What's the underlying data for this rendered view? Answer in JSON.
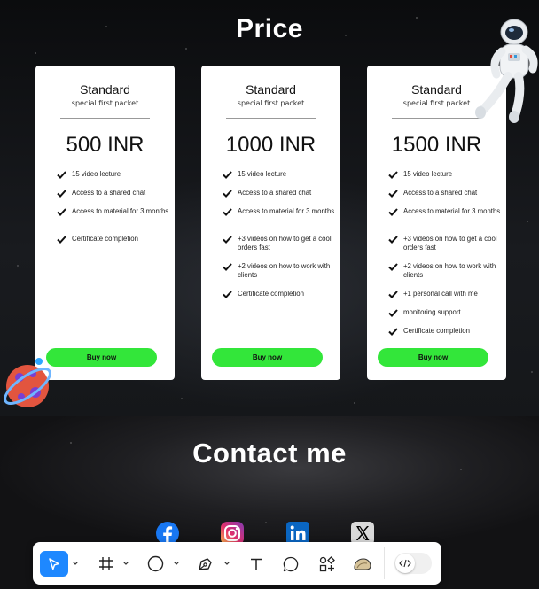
{
  "price_section": {
    "title": "Price"
  },
  "cards": [
    {
      "name": "Standard",
      "subtitle": "special first packet",
      "price": "500 INR",
      "features": [
        "15 video lecture",
        "Access to a shared chat",
        "Access to material for 3 months",
        "Certificate completion"
      ],
      "button": "Buy now"
    },
    {
      "name": "Standard",
      "subtitle": "special first packet",
      "price": "1000 INR",
      "features": [
        "15 video lecture",
        "Access to a shared chat",
        "Access to material for 3 months",
        "+3 videos on how to get a cool orders fast",
        "+2 videos on how to work with clients",
        "Certificate completion"
      ],
      "button": "Buy now"
    },
    {
      "name": "Standard",
      "subtitle": "special first packet",
      "price": "1500 INR",
      "features": [
        "15 video lecture",
        "Access to a shared chat",
        "Access to material for 3 months",
        "+3 videos on how to get a cool orders fast",
        "+2 videos on how to work with clients",
        "+1 personal call with me",
        "monitoring support",
        "Certificate completion"
      ],
      "button": "Buy now"
    }
  ],
  "contact_section": {
    "title": "Contact me",
    "socials": [
      {
        "icon": "facebook-icon",
        "color": "#1877f2"
      },
      {
        "icon": "instagram-icon",
        "color": "#e1306c"
      },
      {
        "icon": "linkedin-icon",
        "color": "#0a66c2"
      },
      {
        "icon": "x-icon",
        "color": "#000000"
      }
    ]
  },
  "toolbar": {
    "tools": [
      {
        "icon": "pointer-icon",
        "active": true,
        "has_menu": true
      },
      {
        "icon": "frame-icon",
        "active": false,
        "has_menu": true
      },
      {
        "icon": "ellipse-icon",
        "active": false,
        "has_menu": true
      },
      {
        "icon": "pen-icon",
        "active": false,
        "has_menu": true
      },
      {
        "icon": "text-icon",
        "active": false,
        "has_menu": false
      },
      {
        "icon": "comment-icon",
        "active": false,
        "has_menu": false
      },
      {
        "icon": "components-icon",
        "active": false,
        "has_menu": false
      },
      {
        "icon": "plugin-icon",
        "active": false,
        "has_menu": false
      }
    ],
    "dev_mode_toggle": {
      "icon": "code-icon",
      "on": false
    }
  },
  "colors": {
    "accent_green": "#33e63a",
    "toolbar_active": "#1e88ff"
  }
}
